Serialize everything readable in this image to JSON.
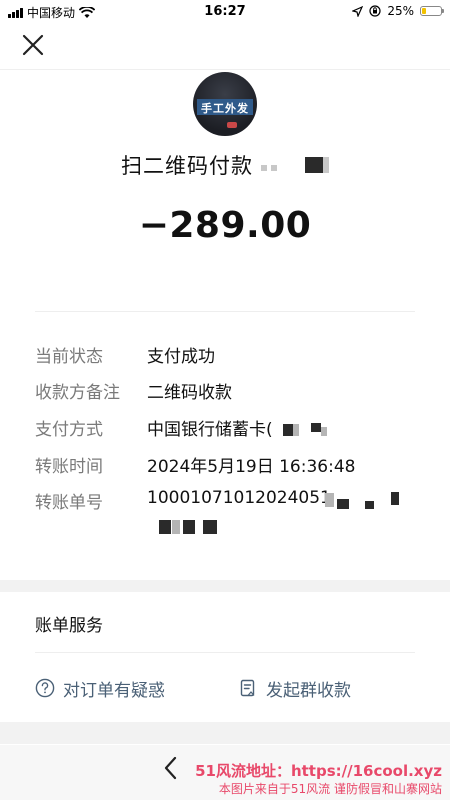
{
  "status_bar": {
    "carrier": "中国移动",
    "time": "16:27",
    "battery_percent": "25%",
    "battery_level": 0.25,
    "battery_color": "#f2c200",
    "icons": [
      "signal-icon",
      "wifi-icon",
      "location-icon",
      "orientation-lock-icon",
      "battery-icon"
    ]
  },
  "header": {
    "close_icon": "close-icon"
  },
  "merchant": {
    "avatar_text": "手工外发",
    "title": "扫二维码付款"
  },
  "amount": "−289.00",
  "details": [
    {
      "label": "当前状态",
      "value": "支付成功"
    },
    {
      "label": "收款方备注",
      "value": "二维码收款"
    },
    {
      "label": "支付方式",
      "value": "中国银行储蓄卡("
    },
    {
      "label": "转账时间",
      "value": "2024年5月19日 16:36:48"
    },
    {
      "label": "转账单号",
      "value": "10001071012024051"
    }
  ],
  "bill_service": {
    "title": "账单服务",
    "items": [
      {
        "label": "对订单有疑惑",
        "icon": "question-circle-icon"
      },
      {
        "label": "发起群收款",
        "icon": "document-icon"
      }
    ]
  },
  "bottom": {
    "back_icon": "chevron-left-icon"
  },
  "watermark": {
    "line1": "51风流地址：https://16cool.xyz",
    "line2": "本图片来自于51风流  谨防假冒和山寨网站",
    "color": "#e8496a"
  },
  "colors": {
    "label_gray": "#7a7a7a",
    "link_blue_gray": "#4a6076",
    "band_gray": "#f2f2f2"
  }
}
